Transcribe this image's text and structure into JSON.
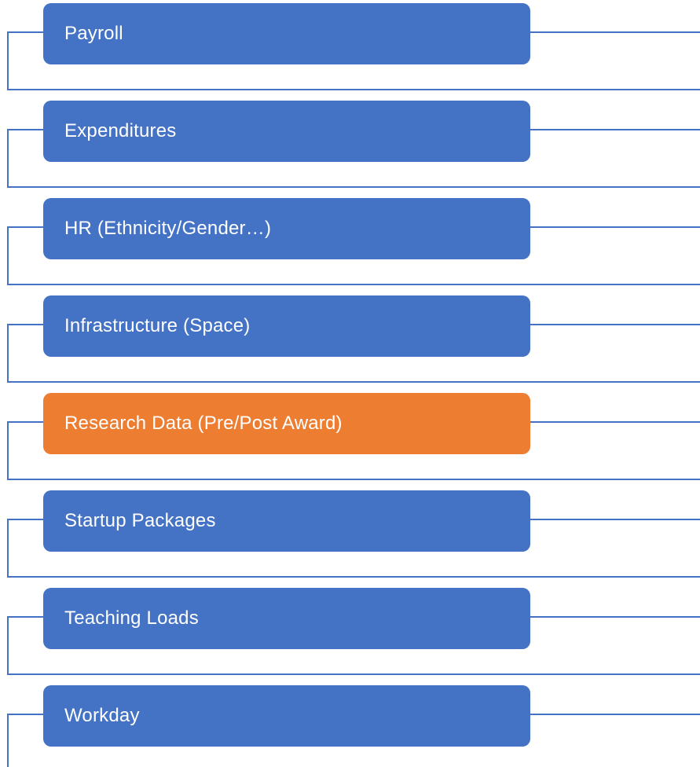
{
  "colors": {
    "box_default": "#4472C4",
    "box_highlight": "#ED7D31",
    "connector": "#4472C4",
    "text": "#FFFFFF"
  },
  "items": [
    {
      "label": "Payroll",
      "highlighted": false
    },
    {
      "label": "Expenditures",
      "highlighted": false
    },
    {
      "label": "HR (Ethnicity/Gender…)",
      "highlighted": false
    },
    {
      "label": "Infrastructure (Space)",
      "highlighted": false
    },
    {
      "label": "Research Data (Pre/Post Award)",
      "highlighted": true
    },
    {
      "label": "Startup Packages",
      "highlighted": false
    },
    {
      "label": "Teaching Loads",
      "highlighted": false
    },
    {
      "label": "Workday",
      "highlighted": false
    }
  ]
}
